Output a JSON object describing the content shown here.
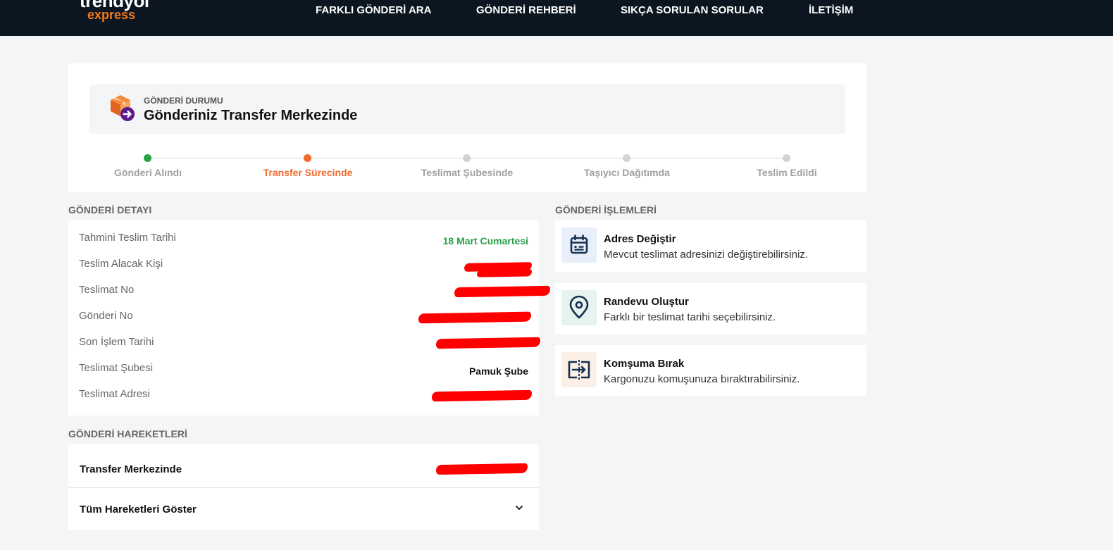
{
  "header": {
    "logo_brand": "trendyol",
    "logo_sub": "express",
    "nav": [
      {
        "label": "FARKLI GÖNDERİ ARA"
      },
      {
        "label": "GÖNDERİ REHBERİ"
      },
      {
        "label": "SIKÇA SORULAN SORULAR"
      },
      {
        "label": "İLETİŞİM"
      }
    ]
  },
  "status": {
    "label": "GÖNDERİ DURUMU",
    "title": "Gönderiniz Transfer Merkezinde",
    "icon": "package-forward-icon",
    "steps": [
      {
        "label": "Gönderi Alındı",
        "state": "done",
        "color": "#27a046"
      },
      {
        "label": "Transfer Sürecinde",
        "state": "current",
        "color": "#f26a2e"
      },
      {
        "label": "Teslimat Şubesinde",
        "state": "pending",
        "color": "#a0a0a0"
      },
      {
        "label": "Taşıyıcı Dağıtımda",
        "state": "pending",
        "color": "#a0a0a0"
      },
      {
        "label": "Teslim Edildi",
        "state": "pending",
        "color": "#a0a0a0"
      }
    ]
  },
  "detail": {
    "title": "GÖNDERİ DETAYI",
    "rows": [
      {
        "label": "Tahmini Teslim Tarihi",
        "value": "18 Mart Cumartesi"
      },
      {
        "label": "Teslim Alacak Kişi",
        "value": ""
      },
      {
        "label": "Teslimat No",
        "value": ""
      },
      {
        "label": "Gönderi No",
        "value": ""
      },
      {
        "label": "Son İşlem Tarihi",
        "value": ""
      },
      {
        "label": "Teslimat Şubesi",
        "value": "Pamuk Şube"
      },
      {
        "label": "Teslimat Adresi",
        "value": ""
      }
    ]
  },
  "actions": {
    "title": "GÖNDERİ İŞLEMLERİ",
    "items": [
      {
        "title": "Adres Değiştir",
        "desc": "Mevcut teslimat adresinizi değiştirebilirsiniz.",
        "icon": "calendar-icon",
        "bg": "#e8effa"
      },
      {
        "title": "Randevu Oluştur",
        "desc": "Farklı bir teslimat tarihi seçebilirsiniz.",
        "icon": "location-pin-icon",
        "bg": "#e6f3ee"
      },
      {
        "title": "Komşuma Bırak",
        "desc": "Kargonuzu komuşunuza bıraktırabilirsiniz.",
        "icon": "handover-icon",
        "bg": "#fbefe6"
      }
    ]
  },
  "moves": {
    "title": "GÖNDERİ HAREKETLERİ",
    "latest": "Transfer Merkezinde",
    "show_all": "Tüm Hareketleri Göster"
  },
  "colors": {
    "header_bg": "#0b1620",
    "accent_orange": "#f27a1a",
    "success_green": "#27a046",
    "icon_navy": "#16304f"
  }
}
